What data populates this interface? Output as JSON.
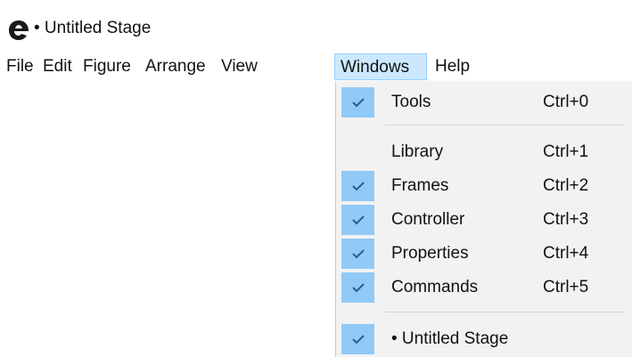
{
  "window": {
    "title": "• Untitled Stage",
    "logo_icon": "app-logo-icon"
  },
  "menubar": {
    "items": [
      {
        "label": "File"
      },
      {
        "label": "Edit"
      },
      {
        "label": "Figure"
      },
      {
        "label": "Arrange"
      },
      {
        "label": "View"
      },
      {
        "label": "Windows",
        "active": true
      },
      {
        "label": "Help"
      }
    ]
  },
  "windows_menu": {
    "items": [
      {
        "label": "Tools",
        "shortcut": "Ctrl+0",
        "checked": true
      },
      {
        "label": "Library",
        "shortcut": "Ctrl+1",
        "checked": false
      },
      {
        "label": "Frames",
        "shortcut": "Ctrl+2",
        "checked": true
      },
      {
        "label": "Controller",
        "shortcut": "Ctrl+3",
        "checked": true
      },
      {
        "label": "Properties",
        "shortcut": "Ctrl+4",
        "checked": true
      },
      {
        "label": "Commands",
        "shortcut": "Ctrl+5",
        "checked": true
      },
      {
        "label": "• Untitled Stage",
        "shortcut": "",
        "checked": true
      }
    ]
  },
  "colors": {
    "menu_highlight": "#cce8ff",
    "check_background": "#91c9f7",
    "dropdown_background": "#f2f2f2"
  }
}
